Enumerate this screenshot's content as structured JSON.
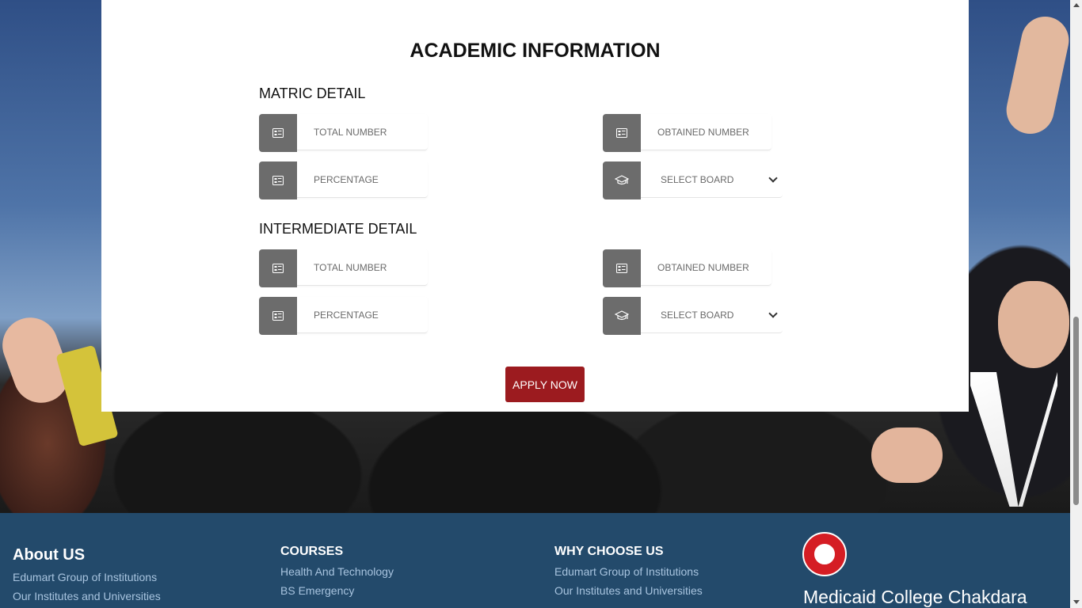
{
  "form": {
    "title": "ACADEMIC INFORMATION",
    "matric": {
      "heading": "MATRIC DETAIL",
      "total_placeholder": "TOTAL NUMBER",
      "obtained_placeholder": "OBTAINED NUMBER",
      "percentage_placeholder": "PERCENTAGE",
      "board_select": "SELECT BOARD"
    },
    "intermediate": {
      "heading": "INTERMEDIATE DETAIL",
      "total_placeholder": "TOTAL NUMBER",
      "obtained_placeholder": "OBTAINED NUMBER",
      "percentage_placeholder": "PERCENTAGE",
      "board_select": "SELECT BOARD"
    },
    "apply_label": "APPLY NOW"
  },
  "footer": {
    "about": {
      "heading": "About US",
      "links": [
        "Edumart Group of Institutions",
        "Our Institutes and Universities"
      ]
    },
    "courses": {
      "heading": "COURSES",
      "links": [
        "Health And Technology",
        "BS Emergency"
      ]
    },
    "why": {
      "heading": "WHY CHOOSE US",
      "links": [
        "Edumart Group of Institutions",
        "Our Institutes and Universities"
      ]
    },
    "brand_name": "Medicaid College Chakdara"
  },
  "colors": {
    "accent": "#9c1b1f",
    "footer_bg": "#234a6b",
    "icon_box": "#6c6c6c",
    "footer_link": "#a8c4df"
  },
  "icons": {
    "number_field": "id-card-icon",
    "board_field": "graduation-cap-icon",
    "select_arrow": "chevron-down-icon"
  }
}
